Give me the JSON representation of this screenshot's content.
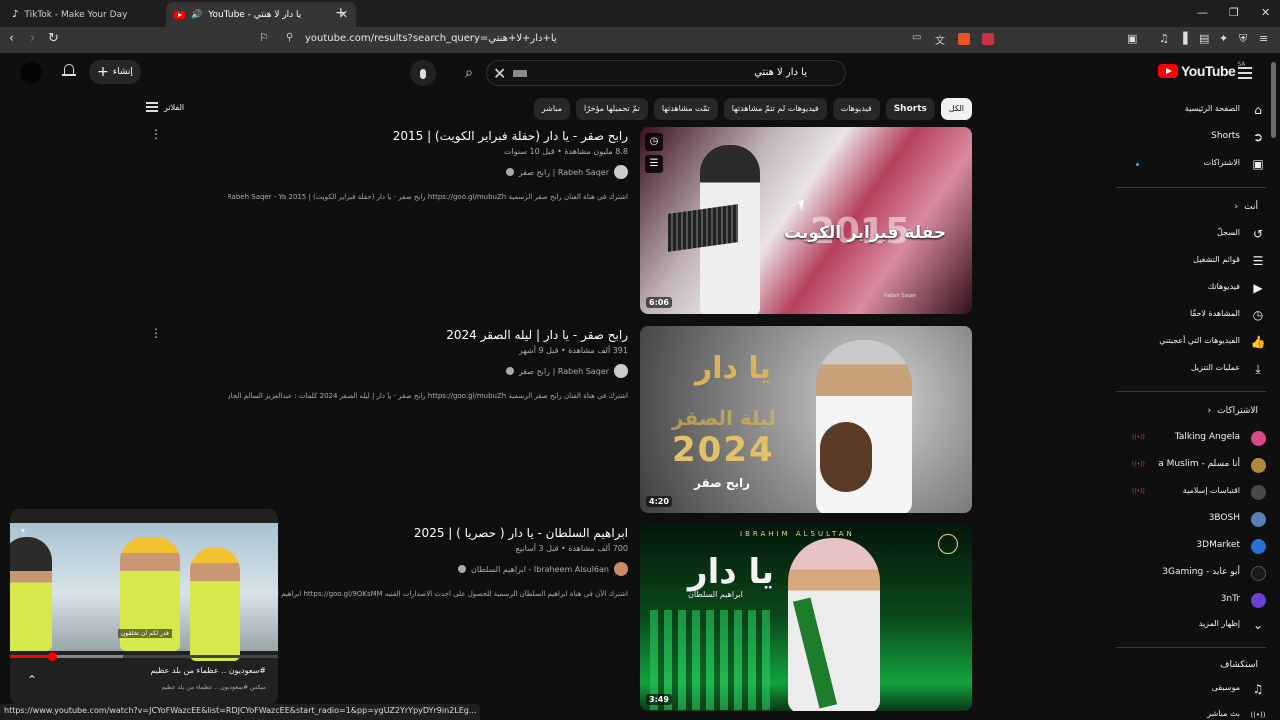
{
  "browser": {
    "tabs": [
      {
        "title": "TikTok - Make Your Day",
        "active": false,
        "close": ""
      },
      {
        "title": "YouTube - يا دار لا هنتي",
        "active": true,
        "close": "✕"
      }
    ],
    "new_tab": "+",
    "window_controls": [
      "—",
      "❐",
      "✕"
    ],
    "url": "youtube.com/results?search_query=يا+دار+لا+هنتي",
    "status_url": "https://www.youtube.com/watch?v=JCYoFWazcEE&list=RDJCYoFWazcEE&start_radio=1&pp=ygUZ2YrYpyDYr9in2LEg..."
  },
  "masthead": {
    "logo_text": "YouTube",
    "region": "SA",
    "search_value": "يا دار لا هنتي",
    "create_label": "إنشاء",
    "create_plus": "+",
    "search_icon": "⌕",
    "clear_icon": "✕"
  },
  "chips": [
    {
      "label": "الكل",
      "active": true
    },
    {
      "label": "Shorts",
      "active": false,
      "bold": true
    },
    {
      "label": "فيديوهات",
      "active": false
    },
    {
      "label": "فيديوهات لم تتمّ مشاهدتها",
      "active": false
    },
    {
      "label": "تمّت مشاهدتها",
      "active": false
    },
    {
      "label": "تمّ تحميلها مؤخرًا",
      "active": false
    },
    {
      "label": "مباشر",
      "active": false
    }
  ],
  "filters_label": "الفلاتر",
  "results": [
    {
      "title": "رابح صقر - يا دار (حفلة فبراير الكويت) | 2015",
      "meta": "8.8 مليون مشاهدة • قبل 10 سنوات",
      "channel": "رابح صقر | Rabeh Saqer",
      "description": "اشترك في هناة الفنان رابح صقر الرسمية https://goo.gl/mubuZh رابح صقر - يا دار (حفلة فبراير الكويت) | Rabeh Saqer - Ya 2015 ...",
      "duration": "6:06",
      "overlay_title": "حفلة فبراير الكويت",
      "overlay_year": "2015",
      "overlay_credit": "Rabeh Saqer"
    },
    {
      "title": "رابح صقر - يا دار | ليله الصقر 2024",
      "meta": "391 ألف مشاهدة • قبل 9 أشهر",
      "channel": "رابح صقر | Rabeh Saqer",
      "description": "اشترك في هناة الفنان رابح صقر الرسمية https://goo.gl/mubuZh رابح صقر - يا دار | ليله الصقر 2024 كلمات : عبدالعزيز السالم الحان ...",
      "duration": "4:20",
      "overlay_title": "يا دار",
      "overlay_night": "ليلة الصقر",
      "overlay_year": "2024",
      "overlay_singer": "رابح صقر"
    },
    {
      "title": "ابراهيم السلطان - يا دار ( حصريا ) | 2025",
      "meta": "700 ألف مشاهدة • قبل 3 أسابيع",
      "channel": "ابراهيم السلطان - Ibraheem Alsul6an",
      "description": "اشترك الآن في هناة ابراهيم السلطان الرسمية للحصول على أحدث الاصدارات الفنيه https://goo.gl/9OKsMM ابراهيم السلطان - يا دار ...",
      "duration": "3:49",
      "overlay_name_en": "IBRAHIM ALSULTAN",
      "overlay_title": "يا دار",
      "overlay_name_ar": "ابراهيم السلطان"
    }
  ],
  "guide": {
    "main": [
      {
        "label": "الصفحة الرئيسية",
        "icon": "⌂"
      },
      {
        "label": "Shorts",
        "icon": "➲"
      },
      {
        "label": "الاشتراكات",
        "icon": "▣"
      }
    ],
    "you_header": "أنت",
    "you": [
      {
        "label": "السجلّ",
        "icon": "↺"
      },
      {
        "label": "قوائم التشغيل",
        "icon": "☰"
      },
      {
        "label": "فيديوهاتك",
        "icon": "▶"
      },
      {
        "label": "المشاهدة لاحقًا",
        "icon": "◷"
      },
      {
        "label": "الفيديوهات التي أعجبتني",
        "icon": "👍"
      },
      {
        "label": "عمليات التنزيل",
        "icon": "⤓"
      }
    ],
    "subs_header": "الاشتراكات",
    "subscriptions": [
      {
        "label": "Talking Angela",
        "live": true,
        "color": "#d9488c"
      },
      {
        "label": "أنا مسلم - a Muslim",
        "live": true,
        "color": "#b08a3a"
      },
      {
        "label": "اقتباسات إسلامية",
        "live": true,
        "color": "#4a4a4a"
      },
      {
        "label": "3BOSH",
        "live": false,
        "color": "#5a7fb5"
      },
      {
        "label": "3DMarket",
        "live": false,
        "color": "#2a6fd6"
      },
      {
        "label": "أبو عابد - 3Gaming",
        "live": false,
        "color": "#1a1a1a"
      },
      {
        "label": "3nTr",
        "live": false,
        "color": "#6b3fd1"
      }
    ],
    "show_more": "إظهار المزيد",
    "explore_header": "استكشاف",
    "explore": [
      {
        "label": "موسيقى",
        "icon": "♫"
      },
      {
        "label": "بث مباشر",
        "icon": "((•))"
      }
    ]
  },
  "miniplayer": {
    "title": "#سعوديون .. عظماء من بلد عظيم",
    "channel": "ميكس #سعوديون .. عظماء من بلد عظيم",
    "subtitle": "قدر لكم أن تخلقون",
    "progress": 0.155,
    "buffered": 0.42,
    "expand_icon": "⌃"
  },
  "colors": {
    "background": "#0f0f0f",
    "accent_red": "#ff0000",
    "text": "#f1f1f1",
    "muted": "#aaaaaa"
  }
}
